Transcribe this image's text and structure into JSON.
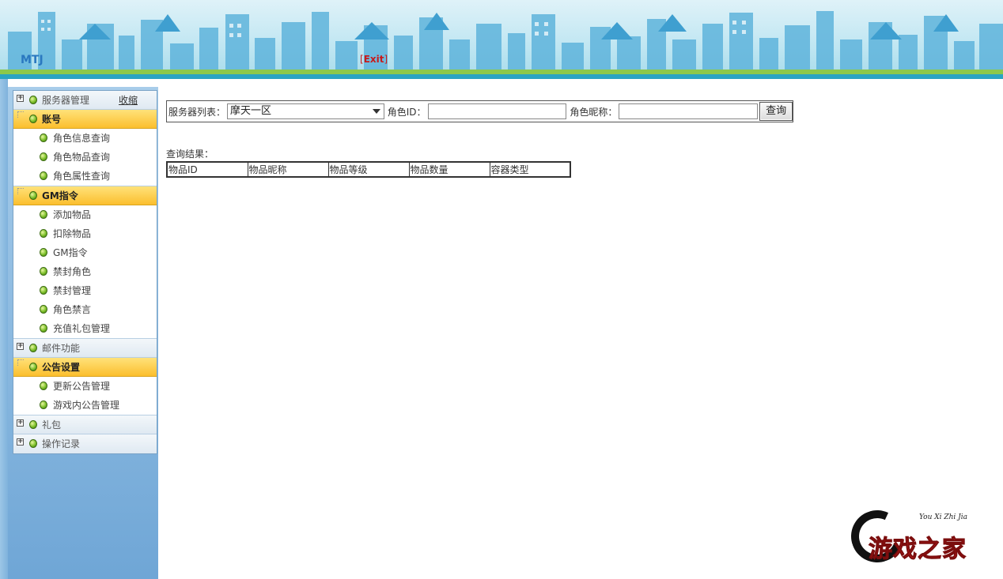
{
  "header": {
    "brand": "MTJ",
    "exit_label": "Exit",
    "exit_left_bracket": "[",
    "exit_right_bracket": "]"
  },
  "sidebar": {
    "collapse_label": "收缩",
    "groups": [
      {
        "label": "服务器管理",
        "state": "collapsed",
        "items": []
      },
      {
        "label": "账号",
        "state": "open",
        "items": [
          "角色信息查询",
          "角色物品查询",
          "角色属性查询"
        ]
      },
      {
        "label": "GM指令",
        "state": "open",
        "items": [
          "添加物品",
          "扣除物品",
          "GM指令",
          "禁封角色",
          "禁封管理",
          "角色禁言",
          "充值礼包管理"
        ]
      },
      {
        "label": "邮件功能",
        "state": "collapsed",
        "items": []
      },
      {
        "label": "公告设置",
        "state": "open",
        "items": [
          "更新公告管理",
          "游戏内公告管理"
        ]
      },
      {
        "label": "礼包",
        "state": "collapsed",
        "items": []
      },
      {
        "label": "操作记录",
        "state": "collapsed",
        "items": []
      }
    ]
  },
  "search": {
    "server_label": "服务器列表：",
    "server_value": "摩天一区",
    "role_id_label": "角色ID：",
    "role_id_value": "",
    "role_name_label": "角色昵称：",
    "role_name_value": "",
    "query_button": "查询"
  },
  "results": {
    "label": "查询结果：",
    "columns": [
      "物品ID",
      "物品昵称",
      "物品等级",
      "物品数量",
      "容器类型"
    ]
  },
  "watermark": {
    "main_text": "游戏之家",
    "sub_text": "You Xi Zhi Jia"
  },
  "colors": {
    "open_group": "#fbbf2e",
    "exit_red": "#c81b1b",
    "brand_blue": "#2a78c0"
  }
}
